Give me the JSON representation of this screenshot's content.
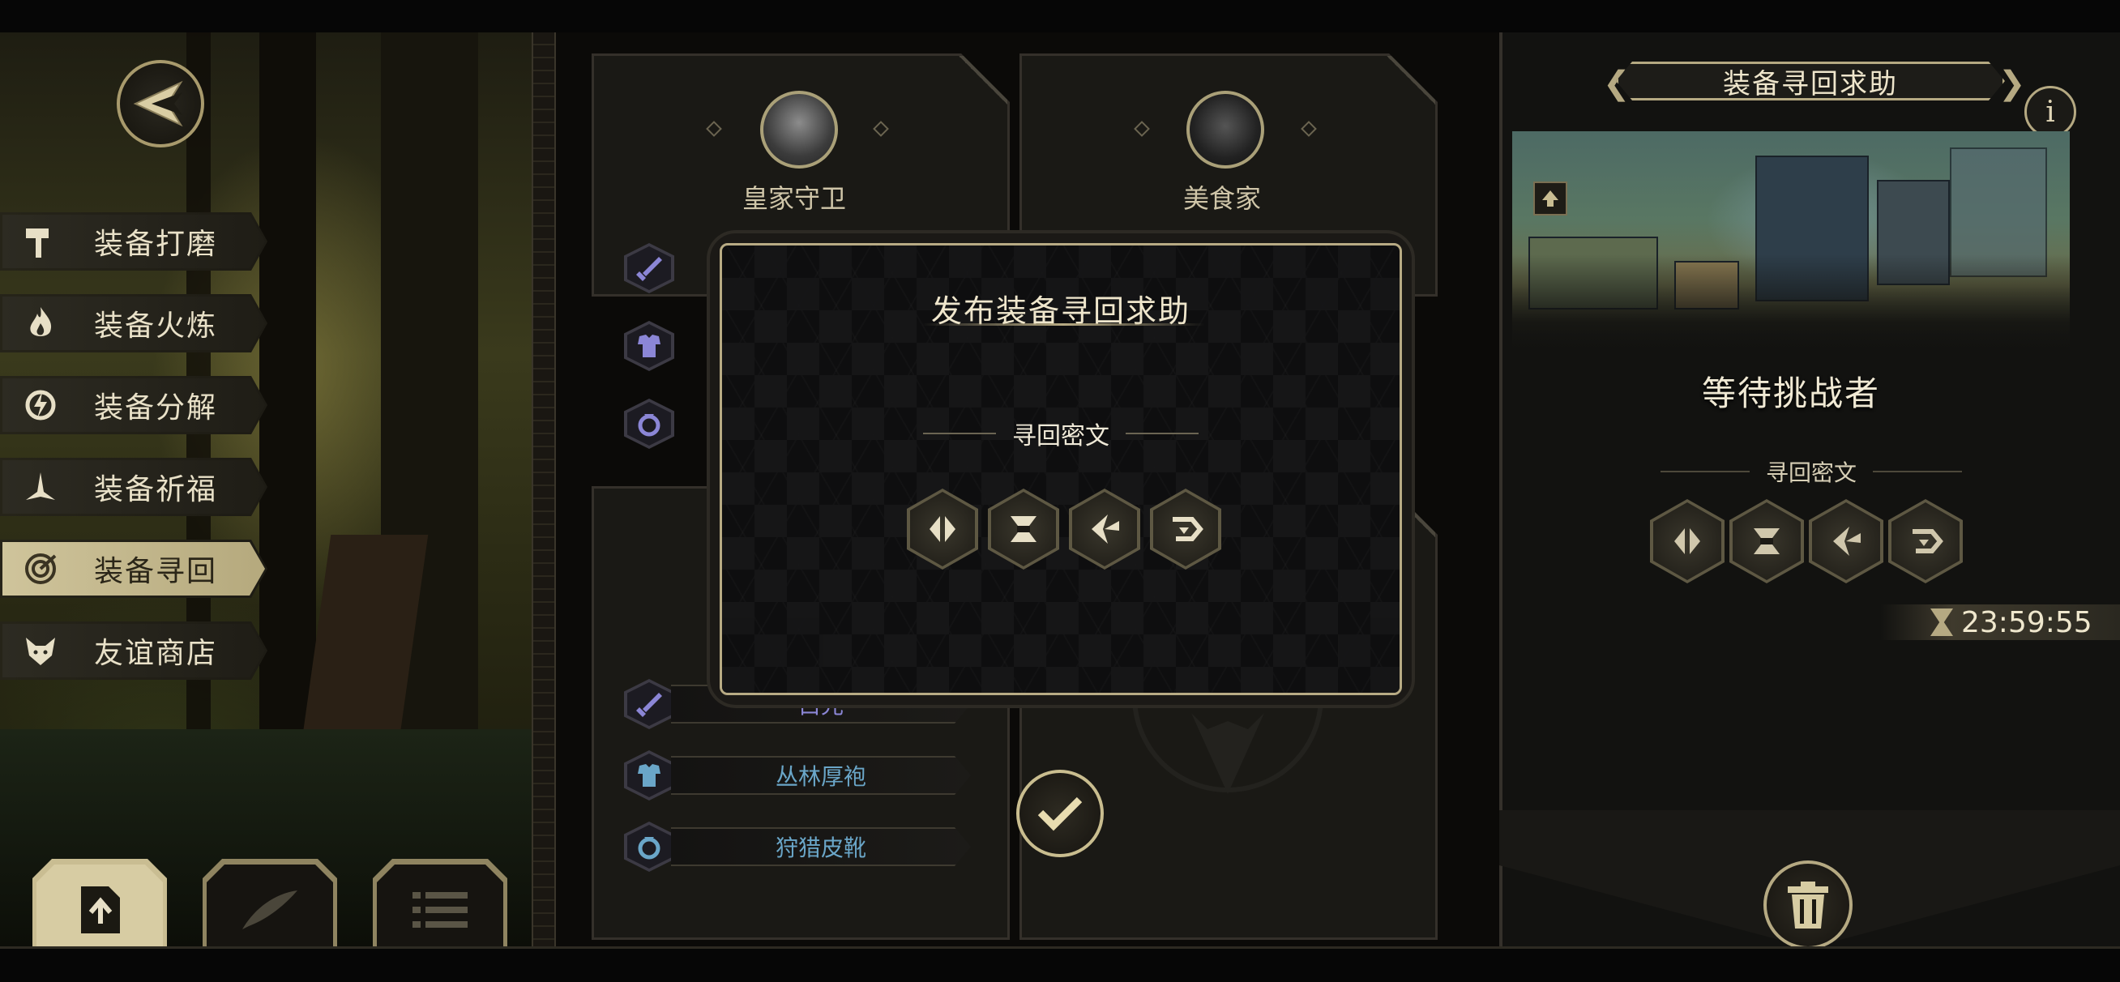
{
  "menu": {
    "items": [
      {
        "label": "装备打磨",
        "icon": "hammer-icon"
      },
      {
        "label": "装备火炼",
        "icon": "flame-icon"
      },
      {
        "label": "装备分解",
        "icon": "disassemble-icon"
      },
      {
        "label": "装备祈福",
        "icon": "prayer-icon"
      },
      {
        "label": "装备寻回",
        "icon": "target-icon",
        "active": true
      },
      {
        "label": "友谊商店",
        "icon": "fox-icon"
      }
    ]
  },
  "bottom_tabs": [
    {
      "icon": "upload-document-icon",
      "active": true
    },
    {
      "icon": "feather-icon",
      "active": false
    },
    {
      "icon": "list-icon",
      "active": false
    }
  ],
  "cards": {
    "left_name": "皇家守卫",
    "right_name": "美食家",
    "left_equip": [
      {
        "name": "白光",
        "icon": "sword-icon",
        "color": "#8b86d6"
      },
      {
        "name": "丛林厚袍",
        "icon": "armor-icon",
        "color": "#6aa6c8"
      },
      {
        "name": "狩猎皮靴",
        "icon": "ring-icon",
        "color": "#6aa6c8"
      }
    ]
  },
  "modal": {
    "title": "发布装备寻回求助",
    "subtitle": "寻回密文",
    "runes": [
      "rune-1-icon",
      "rune-2-icon",
      "rune-3-icon",
      "rune-4-icon"
    ]
  },
  "right_panel": {
    "title": "装备寻回求助",
    "info": "i",
    "status": "等待挑战者",
    "subtitle": "寻回密文",
    "runes": [
      "rune-1-icon",
      "rune-2-icon",
      "rune-3-icon",
      "rune-4-icon"
    ],
    "timer": "23:59:55"
  },
  "colors": {
    "gold": "#b5a982",
    "background": "#121210",
    "equip_purple": "#8b86d6",
    "equip_blue": "#6aa6c8"
  }
}
